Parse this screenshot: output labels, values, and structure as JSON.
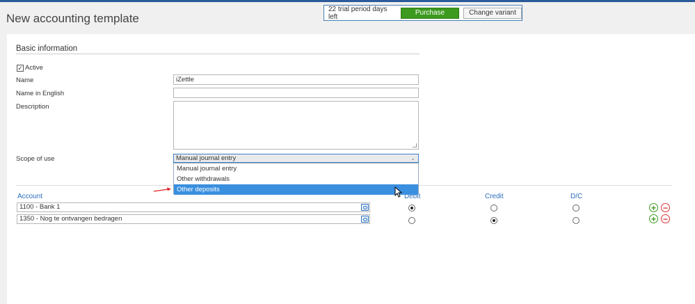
{
  "header": {
    "title": "New accounting template",
    "trial_text": "22 trial period days left",
    "purchase_label": "Purchase",
    "change_variant_label": "Change variant"
  },
  "basic_info": {
    "section_title": "Basic information",
    "active_label": "Active",
    "active_checked": true,
    "name_label": "Name",
    "name_value": "iZettle",
    "name_en_label": "Name in English",
    "name_en_value": "",
    "description_label": "Description",
    "description_value": "",
    "scope_label": "Scope of use",
    "scope_value": "Manual journal entry",
    "scope_options": [
      "Manual journal entry",
      "Other withdrawals",
      "Other deposits"
    ],
    "highlighted_option": "Other deposits"
  },
  "accounts": {
    "columns": {
      "account": "Account",
      "debit": "Debit",
      "credit": "Credit",
      "dc": "D/C"
    },
    "rows": [
      {
        "account": "1100 - Bank 1",
        "selected": "debit"
      },
      {
        "account": "1350 - Nog te ontvangen bedragen",
        "selected": "credit"
      }
    ]
  },
  "colors": {
    "accent": "#2a6ebb",
    "purchase": "#3c9a1f",
    "highlight": "#3a8fdf",
    "remove": "#dd3333"
  },
  "icons": [
    "lookup-icon",
    "add-row-icon",
    "remove-row-icon",
    "chevron-down-icon",
    "mouse-cursor-icon",
    "red-arrow-icon"
  ]
}
